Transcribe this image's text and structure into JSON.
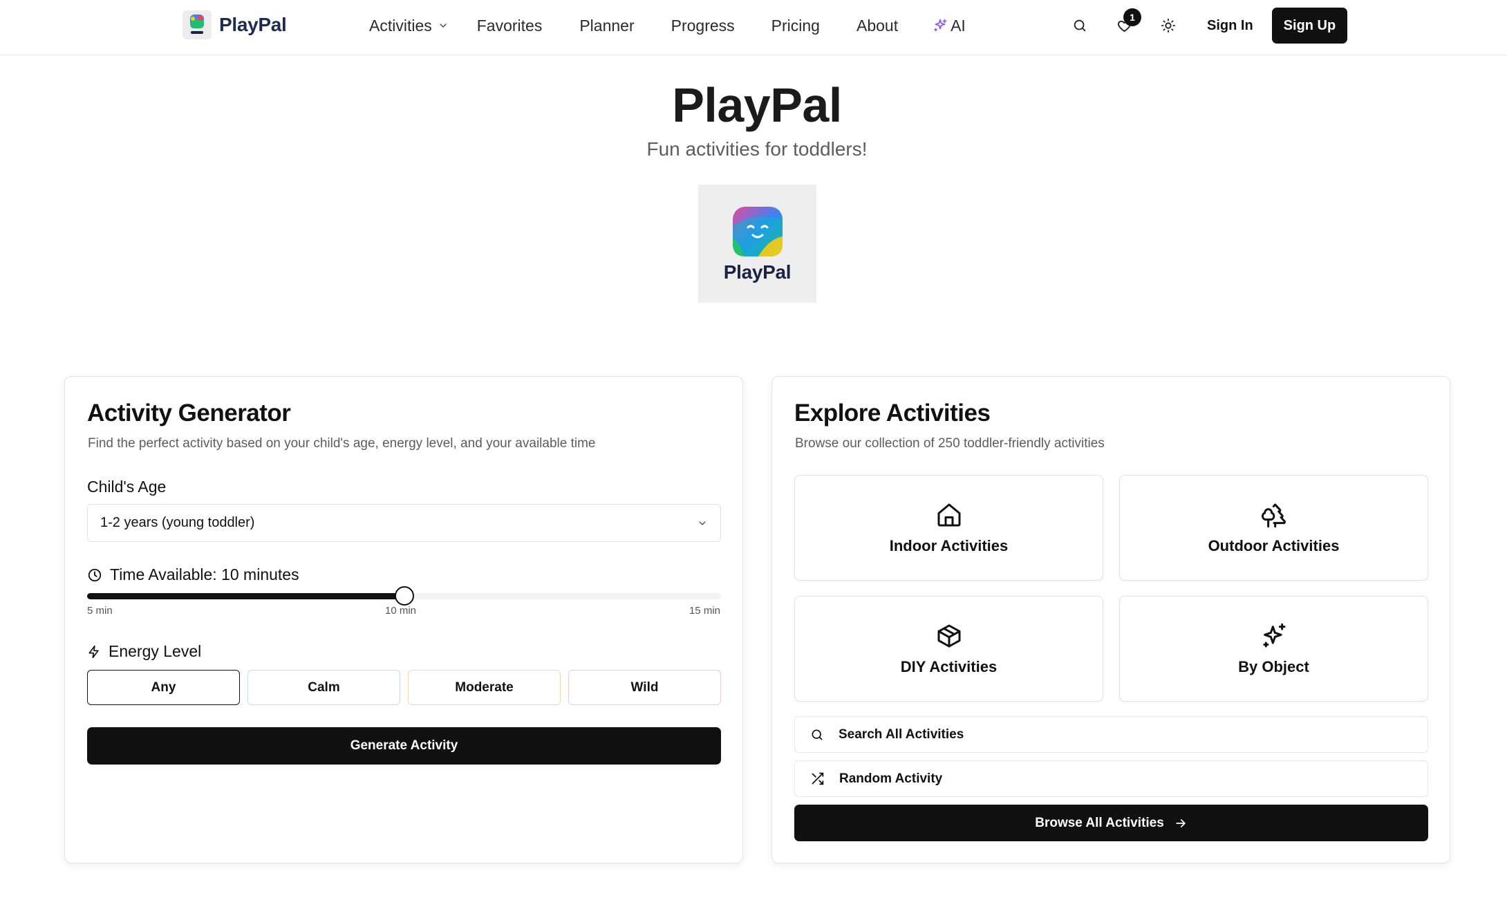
{
  "header": {
    "brand": "PlayPal",
    "brand_logo_text": "PlayPal",
    "nav": [
      "Activities",
      "Favorites",
      "Planner",
      "Progress",
      "Pricing",
      "About",
      "AI"
    ],
    "favorites_count": "1",
    "sign_in": "Sign In",
    "sign_up": "Sign Up",
    "icons": [
      "search-icon",
      "heart-icon",
      "sun-icon"
    ]
  },
  "hero": {
    "title": "PlayPal",
    "subtitle": "Fun activities for toddlers!",
    "logo_text": "PlayPal"
  },
  "generator": {
    "title": "Activity Generator",
    "description": "Find the perfect activity based on your child's age, energy level, and your available time",
    "age_label": "Child's Age",
    "age_value": "1-2 years (young toddler)",
    "time_label": "Time Available: 10 minutes",
    "time_min": 5,
    "time_max": 15,
    "time_value": 10,
    "ticks": [
      "5 min",
      "10 min",
      "15 min"
    ],
    "energy_label": "Energy Level",
    "energy_options": [
      "Any",
      "Calm",
      "Moderate",
      "Wild"
    ],
    "energy_selected": "Any",
    "generate_label": "Generate Activity"
  },
  "explore": {
    "title": "Explore Activities",
    "description": "Browse our collection of 250 toddler-friendly activities",
    "tiles": [
      {
        "label": "Indoor Activities",
        "icon": "home-icon"
      },
      {
        "label": "Outdoor Activities",
        "icon": "trees-icon"
      },
      {
        "label": "DIY Activities",
        "icon": "box-icon"
      },
      {
        "label": "By Object",
        "icon": "sparkles-icon"
      }
    ],
    "search_label": "Search All Activities",
    "random_label": "Random Activity",
    "browse_label": "Browse All Activities"
  },
  "colors": {
    "primary": "#111111",
    "ai_accent": "#8b5cf6",
    "calm_border": "#c5dcf2",
    "moderate_border": "#f6d7b3",
    "wild_border": "#f3cbc7"
  }
}
